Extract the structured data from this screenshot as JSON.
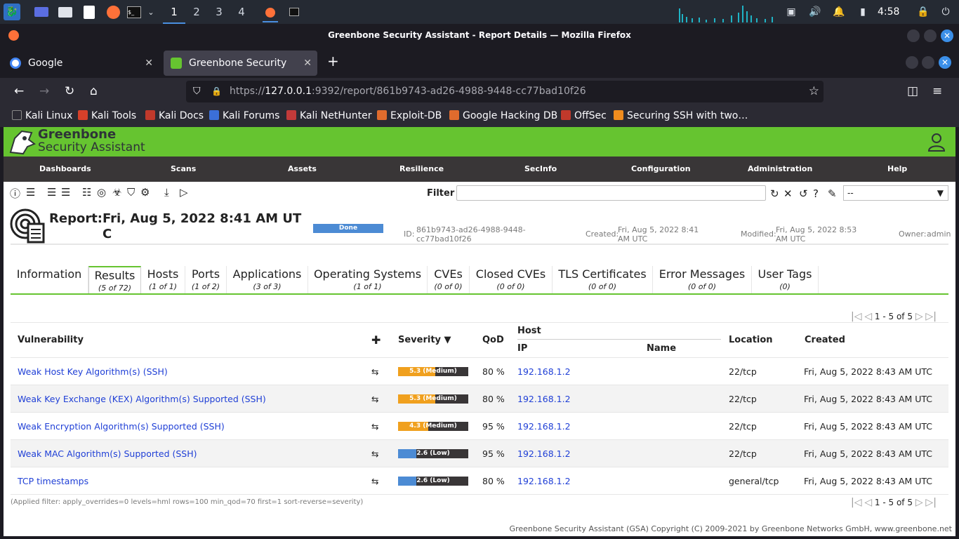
{
  "os": {
    "workspaces": [
      "1",
      "2",
      "3",
      "4"
    ],
    "active_workspace": 0,
    "clock": "4:58",
    "icons": [
      "kali-menu-icon",
      "desktop-icon",
      "files-icon",
      "editor-icon",
      "firefox-icon",
      "terminal-icon"
    ]
  },
  "window": {
    "title": "Greenbone Security Assistant - Report Details — Mozilla Firefox"
  },
  "browser": {
    "tabs": [
      {
        "label": "Google",
        "active": false
      },
      {
        "label": "Greenbone Security Assist",
        "active": true
      }
    ],
    "url_prefix": "https://",
    "url_host": "127.0.0.1",
    "url_rest": ":9392/report/861b9743-ad26-4988-9448-cc77bad10f26",
    "bookmarks": [
      "Kali Linux",
      "Kali Tools",
      "Kali Docs",
      "Kali Forums",
      "Kali NetHunter",
      "Exploit-DB",
      "Google Hacking DB",
      "OffSec",
      "Securing SSH with two…"
    ]
  },
  "gsa": {
    "logo_line1": "Greenbone",
    "logo_line2": "Security Assistant",
    "menu": [
      "Dashboards",
      "Scans",
      "Assets",
      "Resilience",
      "SecInfo",
      "Configuration",
      "Administration",
      "Help"
    ],
    "filter_label": "Filter",
    "filter_value": "",
    "filter_select": "--",
    "colors": {
      "brand": "#66c430",
      "menu_bg": "#393637",
      "link": "#1f3fd6",
      "medium": "#f0a01e",
      "low": "#4c8bd4"
    }
  },
  "report": {
    "title": "Report:",
    "date": "Fri, Aug 5, 2022 8:41 AM UTC",
    "status": "Done",
    "id_label": "ID:",
    "id_value": "861b9743-ad26-4988-9448-cc77bad10f26",
    "created_label": "Created:",
    "created_value": "Fri, Aug 5, 2022 8:41 AM UTC",
    "modified_label": "Modified:",
    "modified_value": "Fri, Aug 5, 2022 8:53 AM UTC",
    "owner_label": "Owner:",
    "owner_value": "admin"
  },
  "tabs": [
    {
      "label": "Information",
      "sub": ""
    },
    {
      "label": "Results",
      "sub": "(5 of 72)"
    },
    {
      "label": "Hosts",
      "sub": "(1 of 1)"
    },
    {
      "label": "Ports",
      "sub": "(1 of 2)"
    },
    {
      "label": "Applications",
      "sub": "(3 of 3)"
    },
    {
      "label": "Operating Systems",
      "sub": "(1 of 1)"
    },
    {
      "label": "CVEs",
      "sub": "(0 of 0)"
    },
    {
      "label": "Closed CVEs",
      "sub": "(0 of 0)"
    },
    {
      "label": "TLS Certificates",
      "sub": "(0 of 0)"
    },
    {
      "label": "Error Messages",
      "sub": "(0 of 0)"
    },
    {
      "label": "User Tags",
      "sub": "(0)"
    }
  ],
  "pager": "1 - 5 of 5",
  "table": {
    "headers": {
      "vulnerability": "Vulnerability",
      "severity": "Severity ▼",
      "qod": "QoD",
      "host": "Host",
      "ip": "IP",
      "name": "Name",
      "location": "Location",
      "created": "Created"
    },
    "rows": [
      {
        "vuln": "Weak Host Key Algorithm(s) (SSH)",
        "sev_label": "5.3 (Medium)",
        "sev_value": 5.3,
        "sev_level": "medium",
        "qod": "80 %",
        "ip": "192.168.1.2",
        "name": "",
        "location": "22/tcp",
        "created": "Fri, Aug 5, 2022 8:43 AM UTC"
      },
      {
        "vuln": "Weak Key Exchange (KEX) Algorithm(s) Supported (SSH)",
        "sev_label": "5.3 (Medium)",
        "sev_value": 5.3,
        "sev_level": "medium",
        "qod": "80 %",
        "ip": "192.168.1.2",
        "name": "",
        "location": "22/tcp",
        "created": "Fri, Aug 5, 2022 8:43 AM UTC"
      },
      {
        "vuln": "Weak Encryption Algorithm(s) Supported (SSH)",
        "sev_label": "4.3 (Medium)",
        "sev_value": 4.3,
        "sev_level": "medium",
        "qod": "95 %",
        "ip": "192.168.1.2",
        "name": "",
        "location": "22/tcp",
        "created": "Fri, Aug 5, 2022 8:43 AM UTC"
      },
      {
        "vuln": "Weak MAC Algorithm(s) Supported (SSH)",
        "sev_label": "2.6 (Low)",
        "sev_value": 2.6,
        "sev_level": "low",
        "qod": "95 %",
        "ip": "192.168.1.2",
        "name": "",
        "location": "22/tcp",
        "created": "Fri, Aug 5, 2022 8:43 AM UTC"
      },
      {
        "vuln": "TCP timestamps",
        "sev_label": "2.6 (Low)",
        "sev_value": 2.6,
        "sev_level": "low",
        "qod": "80 %",
        "ip": "192.168.1.2",
        "name": "",
        "location": "general/tcp",
        "created": "Fri, Aug 5, 2022 8:43 AM UTC"
      }
    ]
  },
  "applied_filter": "(Applied filter: apply_overrides=0 levels=hml rows=100 min_qod=70 first=1 sort-reverse=severity)",
  "footer": "Greenbone Security Assistant (GSA) Copyright (C) 2009-2021 by Greenbone Networks GmbH, www.greenbone.net"
}
